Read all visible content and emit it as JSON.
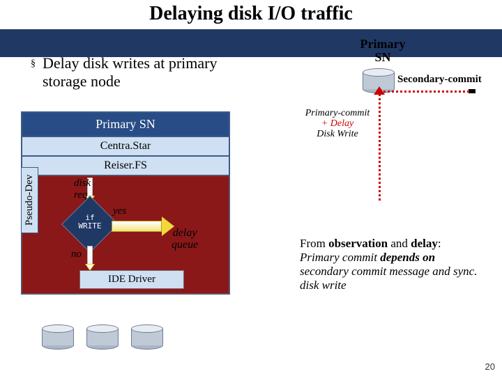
{
  "title": "Delaying disk I/O traffic",
  "bullet": {
    "text": "Delay disk writes at primary storage node"
  },
  "stack": {
    "header": "Primary SN",
    "layer_centrastar": "Centra.Star",
    "layer_reiserfs": "Reiser.FS",
    "pseudo_label": "Pseudo-Dev",
    "disk_req": "disk\nreq",
    "decision": "if\nWRITE",
    "yes": "yes",
    "no": "no",
    "delay_queue": "delay\nqueue",
    "ide": "IDE Driver"
  },
  "right": {
    "primary_sn": "Primary\nSN",
    "secondary_commit": "Secondary-commit",
    "primary_commit_line1": "Primary-commit",
    "primary_commit_delay": "+ Delay",
    "primary_commit_diskwrite": "Disk Write"
  },
  "observation": {
    "line1_pre": "From ",
    "obs_word": "observation",
    "line1_mid": " and ",
    "delay_word": "delay",
    "line1_post": ":",
    "line2_em": "Primary commit ",
    "line2_strong": "depends on",
    "line2_tail": " secondary commit message and sync. disk write"
  },
  "page_no": "20"
}
